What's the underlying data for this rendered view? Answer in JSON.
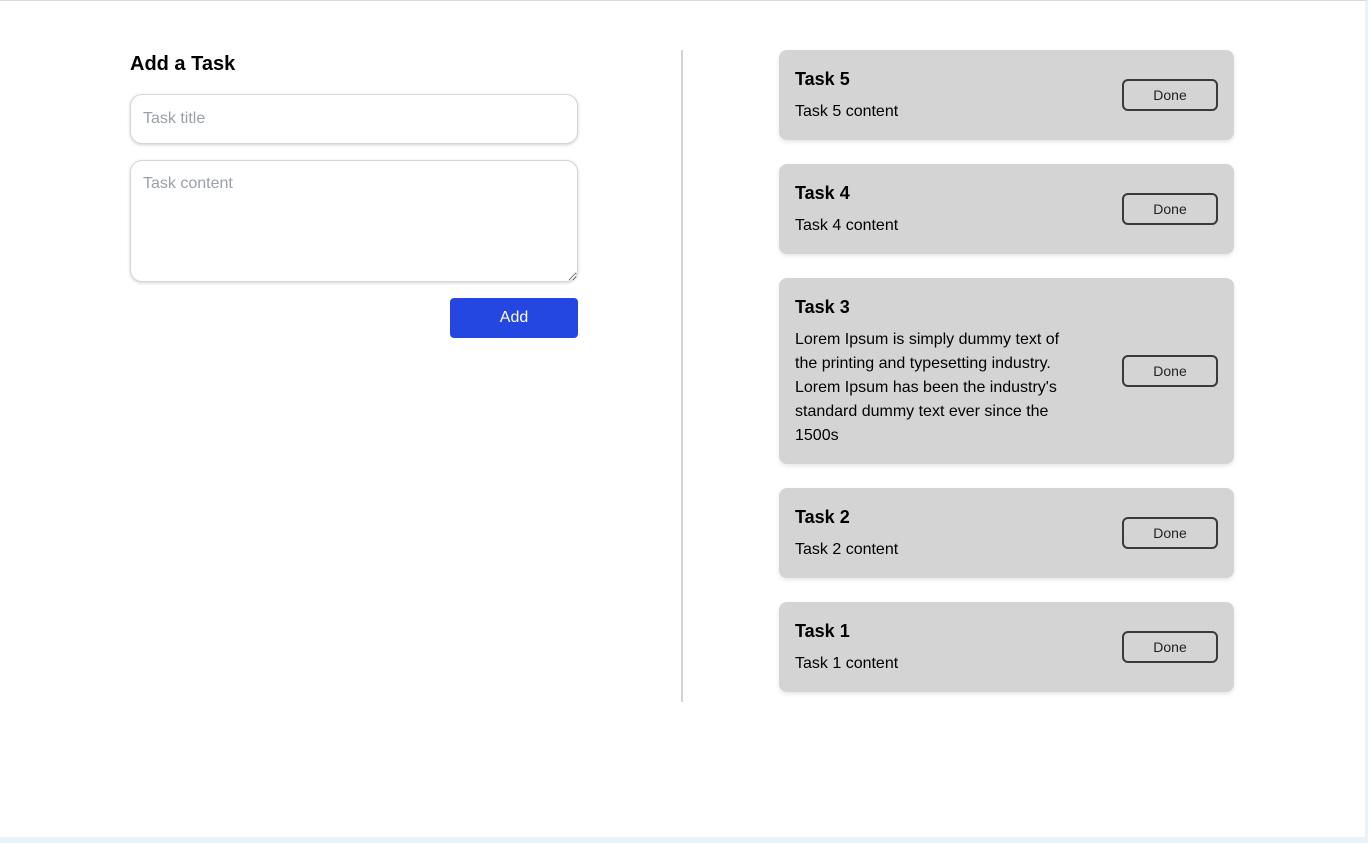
{
  "form": {
    "heading": "Add a Task",
    "title_placeholder": "Task title",
    "title_value": "",
    "content_placeholder": "Task content",
    "content_value": "",
    "add_label": "Add"
  },
  "tasks": [
    {
      "title": "Task 5",
      "content": "Task 5 content",
      "done_label": "Done"
    },
    {
      "title": "Task 4",
      "content": "Task 4 content",
      "done_label": "Done"
    },
    {
      "title": "Task 3",
      "content": "Lorem Ipsum is simply dummy text of the printing and typesetting industry. Lorem Ipsum has been the industry's standard dummy text ever since the 1500s",
      "done_label": "Done"
    },
    {
      "title": "Task 2",
      "content": "Task 2 content",
      "done_label": "Done"
    },
    {
      "title": "Task 1",
      "content": "Task 1 content",
      "done_label": "Done"
    }
  ],
  "colors": {
    "accent": "#2347e0",
    "card_background": "#d4d4d4",
    "divider": "#d4d4d4"
  }
}
